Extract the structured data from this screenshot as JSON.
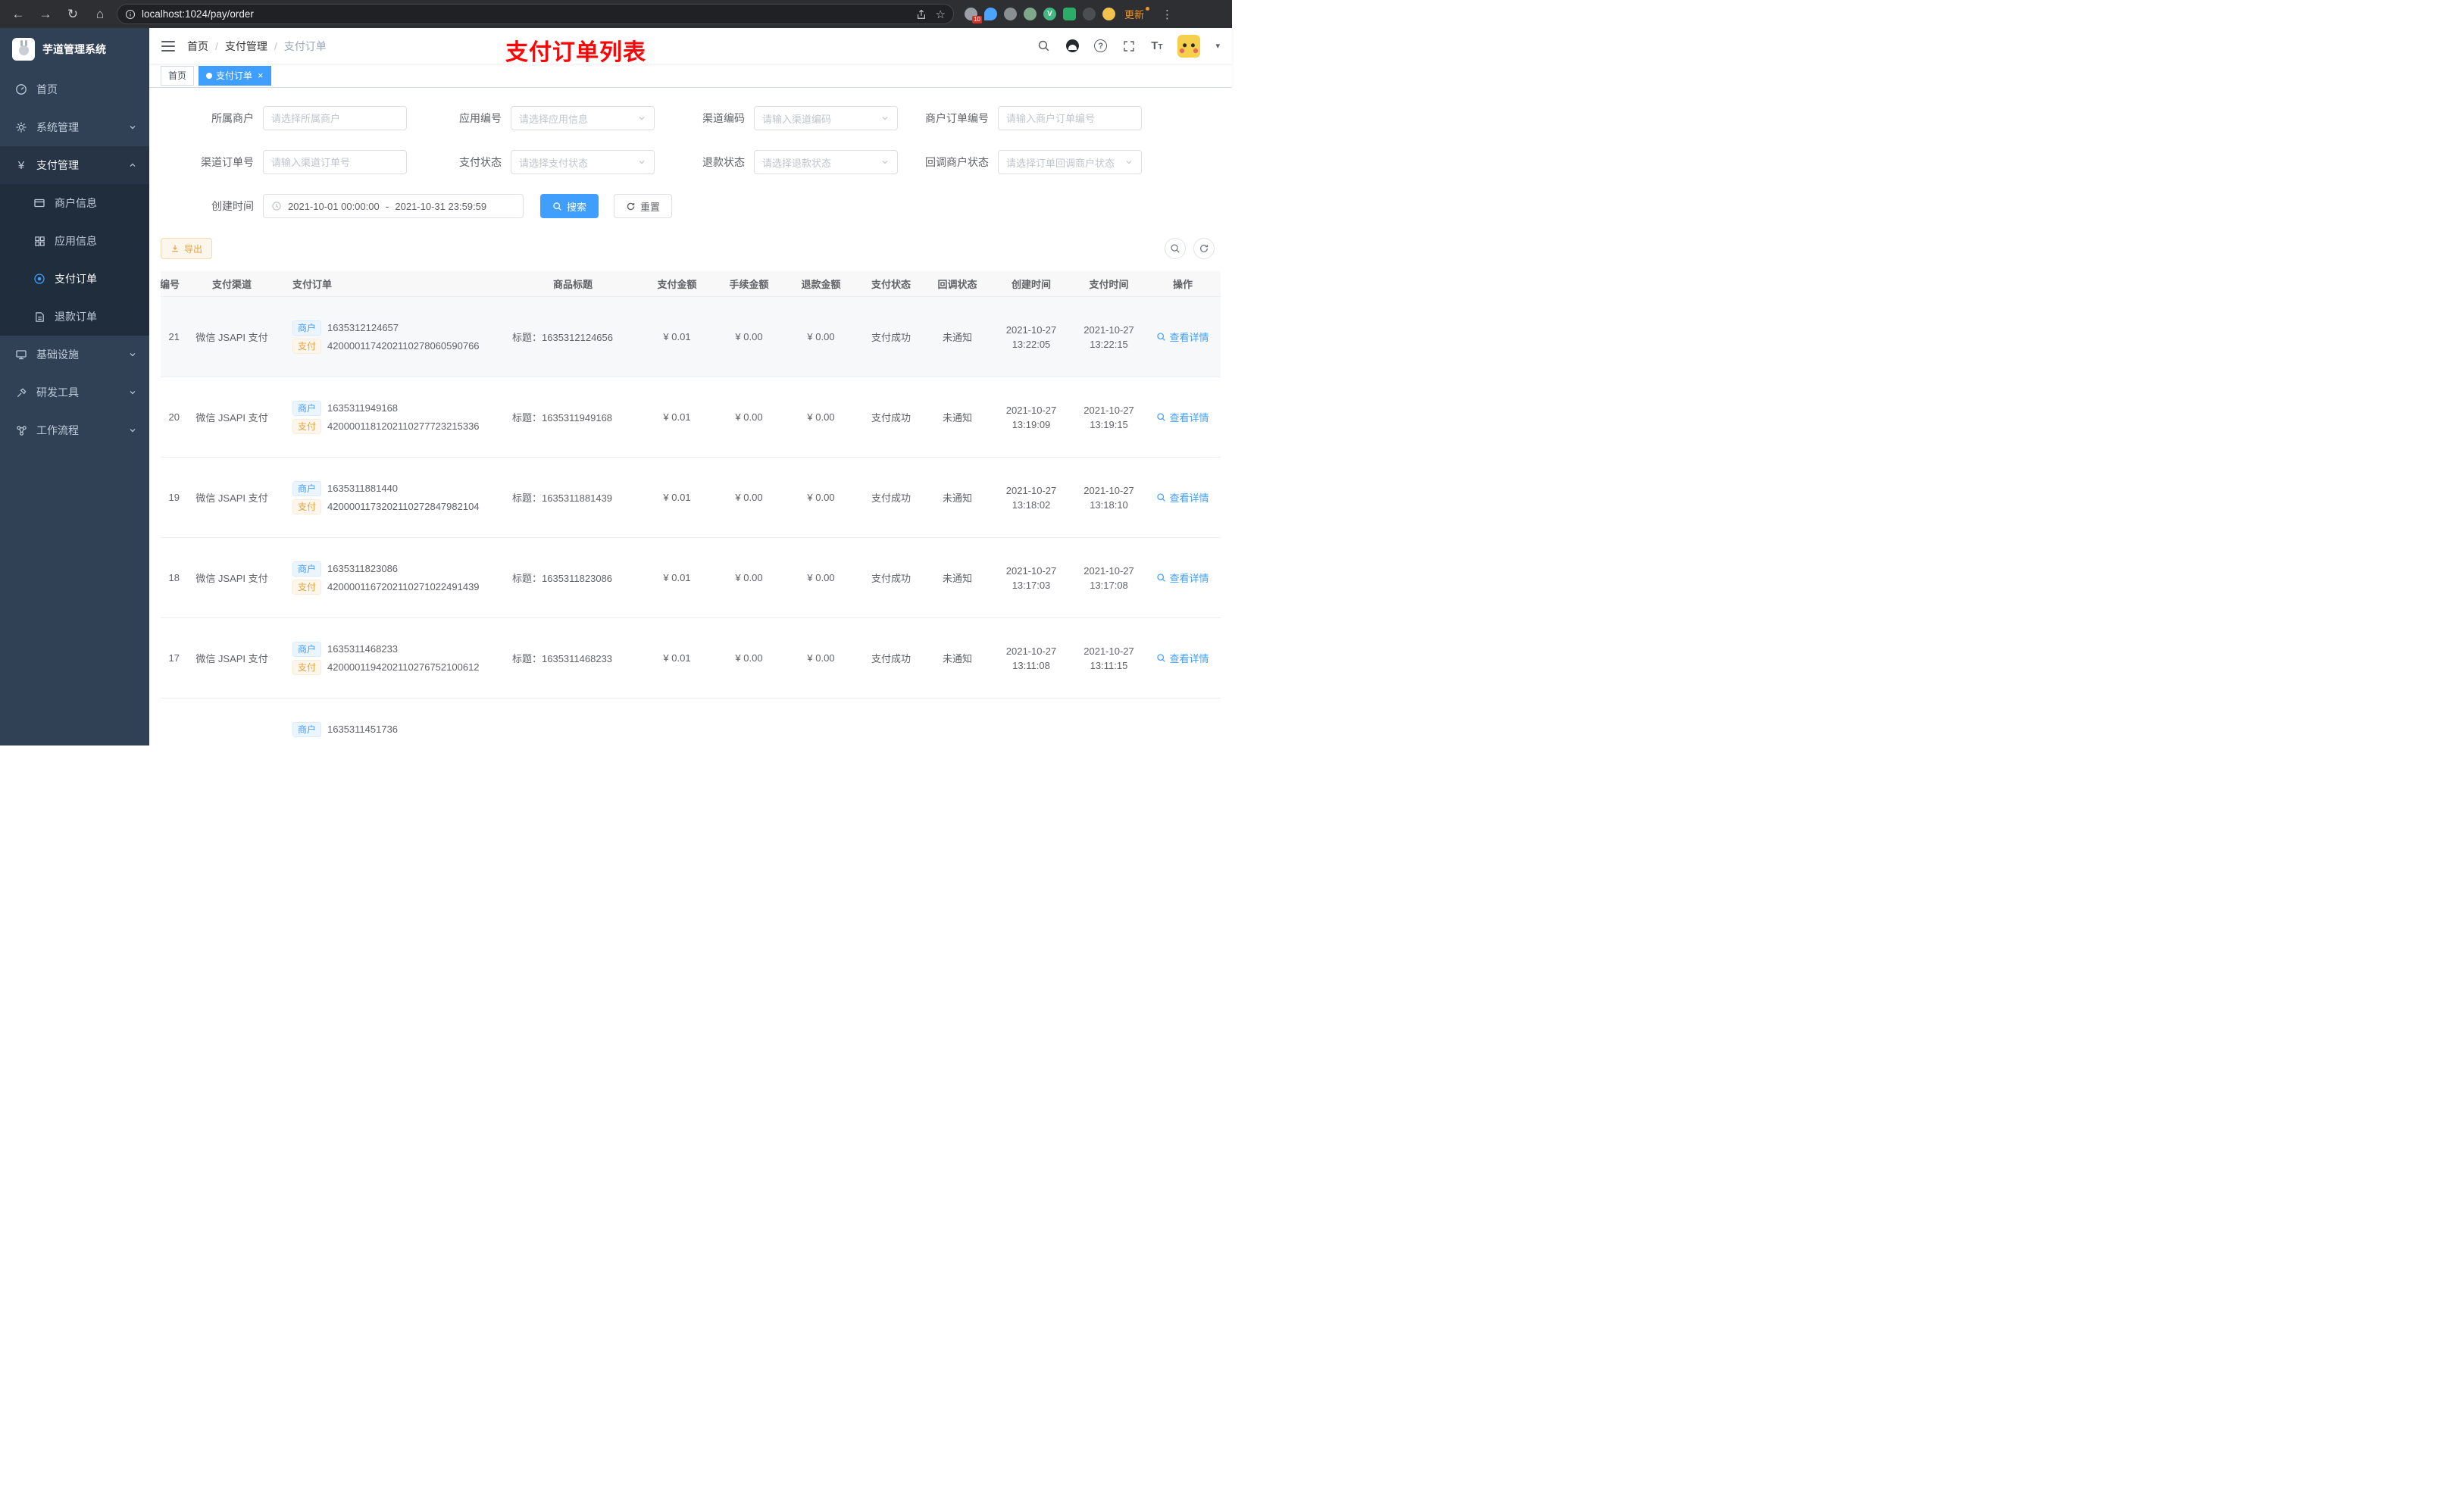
{
  "browser": {
    "url": "localhost:1024/pay/order",
    "update_label": "更新",
    "extension_badge": "10"
  },
  "icons": {
    "back": "←",
    "forward": "→",
    "reload": "↻",
    "home": "⌂",
    "star": "☆",
    "menu_dots": "⋮",
    "yen": "¥",
    "question": "?",
    "caret_down": "▾",
    "font_big": "T",
    "font_small": "T"
  },
  "sidebar": {
    "logo_title": "芋道管理系统",
    "items": [
      {
        "label": "首页"
      },
      {
        "label": "系统管理"
      },
      {
        "label": "支付管理"
      },
      {
        "label": "基础设施"
      },
      {
        "label": "研发工具"
      },
      {
        "label": "工作流程"
      }
    ],
    "pay_children": [
      {
        "label": "商户信息"
      },
      {
        "label": "应用信息"
      },
      {
        "label": "支付订单"
      },
      {
        "label": "退款订单"
      }
    ]
  },
  "header": {
    "breadcrumb": [
      "首页",
      "支付管理",
      "支付订单"
    ],
    "separator": "/",
    "annotation_title": "支付订单列表"
  },
  "tabs": {
    "items": [
      {
        "label": "首页"
      },
      {
        "label": "支付订单"
      }
    ],
    "close": "×"
  },
  "filters": {
    "owner_merchant": {
      "label": "所属商户",
      "placeholder": "请选择所属商户"
    },
    "app_no": {
      "label": "应用编号",
      "placeholder": "请选择应用信息"
    },
    "channel_code": {
      "label": "渠道编码",
      "placeholder": "请输入渠道编码"
    },
    "merchant_order_no": {
      "label": "商户订单编号",
      "placeholder": "请输入商户订单编号"
    },
    "channel_order_no": {
      "label": "渠道订单号",
      "placeholder": "请输入渠道订单号"
    },
    "pay_status": {
      "label": "支付状态",
      "placeholder": "请选择支付状态"
    },
    "refund_status": {
      "label": "退款状态",
      "placeholder": "请选择退款状态"
    },
    "notify_status": {
      "label": "回调商户状态",
      "placeholder": "请选择订单回调商户状态"
    },
    "create_time": {
      "label": "创建时间",
      "start": "2021-10-01 00:00:00",
      "separator": "-",
      "end": "2021-10-31 23:59:59"
    },
    "search_label": "搜索",
    "reset_label": "重置"
  },
  "toolbar": {
    "export_label": "导出"
  },
  "table": {
    "columns": [
      "编号",
      "支付渠道",
      "支付订单",
      "商品标题",
      "支付金额",
      "手续金额",
      "退款金额",
      "支付状态",
      "回调状态",
      "创建时间",
      "支付时间",
      "操作"
    ],
    "merchant_tag": "商户",
    "pay_tag": "支付",
    "action_label": "查看详情",
    "rows": [
      {
        "id": "21",
        "channel": "微信 JSAPI 支付",
        "merchant_no": "1635312124657",
        "pay_no": "4200001174202110278060590766",
        "title": "标题：1635312124656",
        "amount": "¥ 0.01",
        "fee": "¥ 0.00",
        "refund": "¥ 0.00",
        "status": "支付成功",
        "notify": "未通知",
        "create_date": "2021-10-27",
        "create_time": "13:22:05",
        "pay_date": "2021-10-27",
        "pay_time": "13:22:15",
        "hover": true
      },
      {
        "id": "20",
        "channel": "微信 JSAPI 支付",
        "merchant_no": "1635311949168",
        "pay_no": "4200001181202110277723215336",
        "title": "标题：1635311949168",
        "amount": "¥ 0.01",
        "fee": "¥ 0.00",
        "refund": "¥ 0.00",
        "status": "支付成功",
        "notify": "未通知",
        "create_date": "2021-10-27",
        "create_time": "13:19:09",
        "pay_date": "2021-10-27",
        "pay_time": "13:19:15"
      },
      {
        "id": "19",
        "channel": "微信 JSAPI 支付",
        "merchant_no": "1635311881440",
        "pay_no": "4200001173202110272847982104",
        "title": "标题：1635311881439",
        "amount": "¥ 0.01",
        "fee": "¥ 0.00",
        "refund": "¥ 0.00",
        "status": "支付成功",
        "notify": "未通知",
        "create_date": "2021-10-27",
        "create_time": "13:18:02",
        "pay_date": "2021-10-27",
        "pay_time": "13:18:10"
      },
      {
        "id": "18",
        "channel": "微信 JSAPI 支付",
        "merchant_no": "1635311823086",
        "pay_no": "4200001167202110271022491439",
        "title": "标题：1635311823086",
        "amount": "¥ 0.01",
        "fee": "¥ 0.00",
        "refund": "¥ 0.00",
        "status": "支付成功",
        "notify": "未通知",
        "create_date": "2021-10-27",
        "create_time": "13:17:03",
        "pay_date": "2021-10-27",
        "pay_time": "13:17:08"
      },
      {
        "id": "17",
        "channel": "微信 JSAPI 支付",
        "merchant_no": "1635311468233",
        "pay_no": "4200001194202110276752100612",
        "title": "标题：1635311468233",
        "amount": "¥ 0.01",
        "fee": "¥ 0.00",
        "refund": "¥ 0.00",
        "status": "支付成功",
        "notify": "未通知",
        "create_date": "2021-10-27",
        "create_time": "13:11:08",
        "pay_date": "2021-10-27",
        "pay_time": "13:11:15"
      },
      {
        "id": "",
        "channel": "",
        "merchant_no": "1635311451736",
        "pay_no": "",
        "title": "",
        "amount": "",
        "fee": "",
        "refund": "",
        "status": "",
        "notify": "",
        "create_date": "",
        "create_time": "",
        "pay_date": "",
        "pay_time": "",
        "partial": true
      }
    ]
  }
}
